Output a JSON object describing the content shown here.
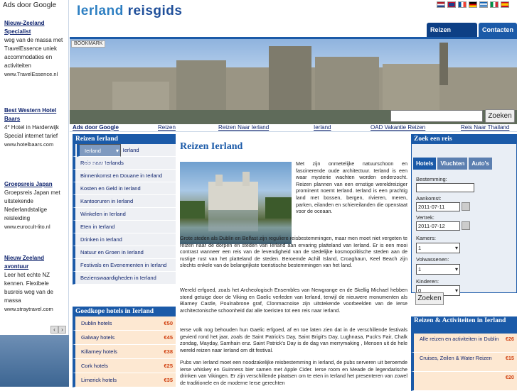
{
  "left_ads": {
    "header": "Ads door Google",
    "ads": [
      {
        "title": "Nieuw-Zeeland Specialist",
        "body": "weg van de massa met TravelEssence uniek accommodaties en activiteiten",
        "url": "www.TravelEssence.nl"
      },
      {
        "title": "Best Western Hotel Baars",
        "body": "4* Hotel in Harderwijk Special internet tarief",
        "url": "www.hotelbaars.com"
      },
      {
        "title": "Groepsreis Japan",
        "body": "Groepsreis Japan met uitstekende Nederlandstalige reisleiding",
        "url": "www.eurocult-lito.nl"
      },
      {
        "title": "Nieuw Zeeland avontuur",
        "body": "Leer het echte NZ kennen. Flexibele busreis weg van de massa",
        "url": "www.straytravel.com"
      }
    ],
    "prev": "‹",
    "next": "›"
  },
  "header": {
    "logo_part1": "Ierland",
    "logo_part2": "reisgids",
    "tabs": [
      "Reizen Ierland",
      "Contacten"
    ],
    "flags": [
      "nl",
      "uk",
      "fr",
      "de",
      "gr",
      "it",
      "es"
    ]
  },
  "banner": {
    "bookmark": "BOOKMARK",
    "search_value": "",
    "search_button": "Zoeken"
  },
  "linkbar": {
    "ads_label": "Ads door Google",
    "links": [
      "Reizen",
      "Reizen Naar Ierland",
      "Ierland",
      "OAD Vakantie Reizen",
      "Reis Naar Thailand"
    ]
  },
  "sidenav": {
    "title": "Reizen Ierland",
    "items": [
      "Ierland Overzicht",
      "Accommodatie in Ierland",
      "Reis naar Ierlands",
      "Binnenkomst en Douane in Ierland",
      "Kosten en Geld in Ierland",
      "Kantooruren in Ierland",
      "Winkelen in Ierland",
      "Eten in Ierland",
      "Drinken in Ierland",
      "Natuur en Groen in Ierland",
      "Festivals en Evenementen in Ierland",
      "Bezienswaardigheden in Ierland"
    ]
  },
  "hotels": {
    "title": "Goedkope hotels in Ierland",
    "items": [
      {
        "name": "Dublin hotels",
        "price": "€50"
      },
      {
        "name": "Galway hotels",
        "price": "€45"
      },
      {
        "name": "Killarney hotels",
        "price": "€38"
      },
      {
        "name": "Cork hotels",
        "price": "€25"
      },
      {
        "name": "Limerick hotels",
        "price": "€35"
      }
    ]
  },
  "main": {
    "title": "Reizen Ierland",
    "p1": "Met zijn onmetelijke natuurschoon en fascinerende oude architectuur. Ierland is een waar mysterie wachten worden onderzocht. Reizen plannen van een ernstige wereldreiziger prominent noemt Ierland. Ierland is een prachtig land met bossen, bergen, rivieren, meren, parken, eilanden en schiereilanden die openstaat voor de oceaan.",
    "p2": "Grote steden als Dublin en Belfast zijn reguliere reisbestemmingen, maar men moet niet vergeten te reizen naar de dorpen en steden van Ierland aan ervaring platteland van Ierland. Er is een mooi contrast wanneer een reis van de levendigheid van de stedelijke kosmopolitische steden aan de rustige rust van het platteland de steden. Beroemde Achill Island, Croaghaun, Keel Beach zijn slechts enkele van de belangrijkste toeristische bestemmingen van het land.",
    "p3": "Wereld erfgoed, zoals het Archeologisch Ensembles van Newgrange en de Skellig Michael hebben stond getuige door de Viking en Gaelic verleden van Ierland, terwijl de nieuwere monumenten als Blarney Castle, Poulnabrone graf, Clonmacnoise zijn uitstekende voorbeelden van de Ierse architectonische schoonheid dat alle toeristen tot een reis naar Ierland.",
    "p4": "Ierse volk nog behouden hun Gaelic erfgoed, af en toe laten zien dat in de verschillende festivals gevierd rond het jaar, zoals de Saint Patrick's Day, Saint Brigit's Day, Lughnasa, Puck's Fair, Chalk zondag, Mayday, Samhain enz. Saint Patrick's Day is de dag van merrymaking , Mensen uit de hele wereld reizen naar Ierland om dit festival.",
    "p5": "Pubs van Ierland moet een noodzakelijke reisbestemming in Ierland, de pubs serveren uit beroemde Ierse whiskey en Guinness bier samen met Apple Cider. Ierse room en Meade de legendarische drinken van Vikingen. Er zijn verschillende plaatsen om te eten in Ierland het presenteren van zowel de traditionele en de moderne Ierse gerechten"
  },
  "booking": {
    "title": "Zoek een reis",
    "tabs": [
      "Hotels",
      "Vluchten",
      "Auto's"
    ],
    "bestemming_label": "Bestemming:",
    "bestemming_value": "",
    "aankomst_label": "Aankomst:",
    "aankomst_value": "2011-07-11",
    "vertrek_label": "Vertrek:",
    "vertrek_value": "2011-07-12",
    "kamers_label": "Kamers:",
    "kamers_value": "1",
    "volwassenen_label": "Volwassenen:",
    "volwassenen_value": "1",
    "kinderen_label": "Kinderen:",
    "kinderen_value": "0",
    "button": "Zoeken"
  },
  "activities": {
    "title": "Reizen & Activiteiten in Ierland",
    "items": [
      {
        "name": "Alle reizen en activiteiten in Dublin",
        "price": "€26"
      },
      {
        "name": "Cruises, Zeilen & Water Reizen",
        "price": "€15"
      },
      {
        "name": "",
        "price": "€20"
      }
    ]
  },
  "colors": {
    "accent": "#1b5aa8",
    "price": "#d04010",
    "hotel_bg": "#fde8d2"
  }
}
